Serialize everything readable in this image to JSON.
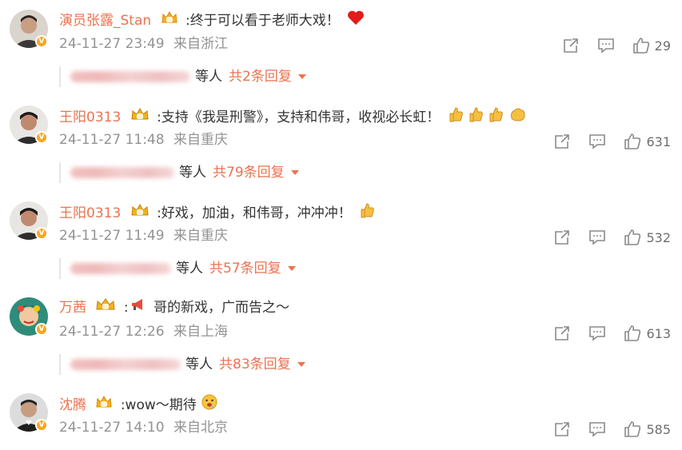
{
  "comments": [
    {
      "username": "演员张露_Stan",
      "text": ":终于可以看于老师大戏！",
      "emoji": "heart-emoji",
      "time": "24-11-27 23:49",
      "location": "来自浙江",
      "likes": "29",
      "reply_suffix": "等人",
      "reply_total": "共2条回复"
    },
    {
      "username": "王阳0313",
      "text": ":支持《我是刑警》，支持和伟哥，收视必长虹！",
      "emoji": "thumbs-up-emoji",
      "time": "24-11-27 11:48",
      "location": "来自重庆",
      "likes": "631",
      "reply_suffix": "等人",
      "reply_total": "共79条回复"
    },
    {
      "username": "王阳0313",
      "text": ":好戏，加油，和伟哥，冲冲冲！",
      "emoji": "thumbs-up-emoji",
      "time": "24-11-27 11:49",
      "location": "来自重庆",
      "likes": "532",
      "reply_suffix": "等人",
      "reply_total": "共57条回复"
    },
    {
      "username": "万茜",
      "text": "哥的新戏，广而告之～",
      "emoji": "megaphone-emoji",
      "time": "24-11-27 12:26",
      "location": "来自上海",
      "likes": "613",
      "reply_suffix": "等人",
      "reply_total": "共83条回复"
    },
    {
      "username": "沈腾",
      "text": ":wow～期待",
      "emoji": "drool-face-emoji",
      "time": "24-11-27 14:10",
      "location": "来自北京",
      "likes": "585"
    }
  ],
  "colors": {
    "username": "#eb7350",
    "meta": "#939393",
    "badge": "#f5a623"
  }
}
